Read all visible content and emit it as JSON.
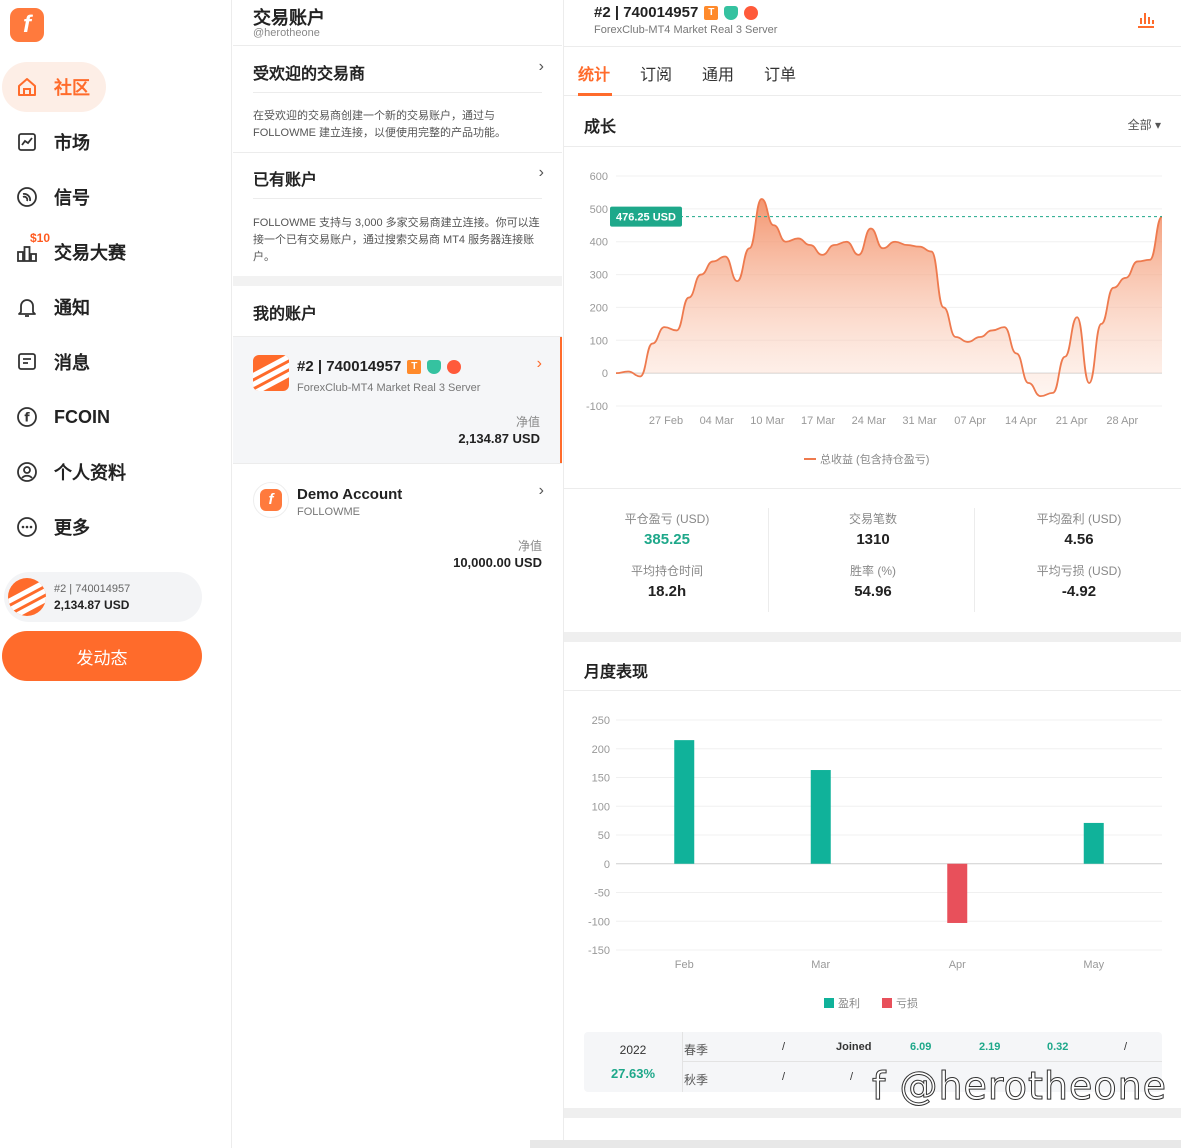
{
  "sidebar": {
    "logo": "f",
    "items": [
      {
        "label": "社区",
        "icon": "home-icon",
        "active": true
      },
      {
        "label": "市场",
        "icon": "market-chart-icon"
      },
      {
        "label": "信号",
        "icon": "signal-icon"
      },
      {
        "label": "交易大赛",
        "icon": "contest-bar-icon",
        "badge": "$10"
      },
      {
        "label": "通知",
        "icon": "bell-icon"
      },
      {
        "label": "消息",
        "icon": "message-icon"
      },
      {
        "label": "FCOIN",
        "icon": "fcoin-icon"
      },
      {
        "label": "个人资料",
        "icon": "profile-icon"
      },
      {
        "label": "更多",
        "icon": "more-icon"
      }
    ],
    "account": {
      "id_line": "#2 | 740014957",
      "balance": "2,134.87 USD"
    },
    "post_button": "发动态"
  },
  "middle": {
    "title": "交易账户",
    "handle": "@herotheone",
    "popular": {
      "title": "受欢迎的交易商",
      "desc": "在受欢迎的交易商创建一个新的交易账户，通过与 FOLLOWME 建立连接，以便使用完整的产品功能。"
    },
    "existing": {
      "title": "已有账户",
      "desc": "FOLLOWME 支持与 3,000 多家交易商建立连接。你可以连接一个已有交易账户，通过搜索交易商 MT4 服务器连接账户。"
    },
    "my_accounts_title": "我的账户",
    "accounts": [
      {
        "name": "#2 | 740014957",
        "server": "ForexClub-MT4 Market Real 3 Server",
        "equity_label": "净值",
        "equity": "2,134.87 USD"
      },
      {
        "name": "Demo Account",
        "server": "FOLLOWME",
        "equity_label": "净值",
        "equity": "10,000.00 USD"
      }
    ]
  },
  "right": {
    "account_title": "#2 | 740014957",
    "account_server": "ForexClub-MT4 Market Real 3 Server",
    "tabs": [
      "统计",
      "订阅",
      "通用",
      "订单"
    ],
    "growth_title": "成长",
    "filter": "全部",
    "monthly_title": "月度表现",
    "stats": [
      {
        "label": "平仓盈亏 (USD)",
        "value": "385.25",
        "green": true
      },
      {
        "label": "交易笔数",
        "value": "1310"
      },
      {
        "label": "平均盈利 (USD)",
        "value": "4.56"
      },
      {
        "label": "平均持仓时间",
        "value": "18.2h"
      },
      {
        "label": "胜率 (%)",
        "value": "54.96"
      },
      {
        "label": "平均亏损 (USD)",
        "value": "-4.92"
      }
    ],
    "season": {
      "year": "2022",
      "pct": "27.63%",
      "rows": [
        {
          "label": "春季",
          "cells": [
            "/",
            "Joined",
            "6.09",
            "2.19",
            "0.32",
            "/"
          ]
        },
        {
          "label": "秋季",
          "cells": [
            "/",
            "/"
          ]
        }
      ]
    },
    "watermark": "f @herotheone"
  },
  "chart_data": [
    {
      "type": "area",
      "title": "成长",
      "ylim": [
        -100,
        600
      ],
      "yticks": [
        600,
        500,
        400,
        300,
        200,
        100,
        0,
        -100
      ],
      "xticks": [
        "27 Feb",
        "04 Mar",
        "10 Mar",
        "17 Mar",
        "24 Mar",
        "31 Mar",
        "07 Apr",
        "14 Apr",
        "21 Apr",
        "28 Apr"
      ],
      "grid": true,
      "legend": "bottom",
      "series": [
        {
          "name": "总收益 (包含持仓盈亏)",
          "color": "#f08a5d",
          "values": [
            0,
            5,
            -10,
            90,
            140,
            130,
            230,
            300,
            340,
            355,
            280,
            380,
            530,
            450,
            400,
            410,
            390,
            360,
            390,
            400,
            360,
            440,
            380,
            400,
            390,
            385,
            370,
            200,
            110,
            95,
            110,
            130,
            140,
            60,
            -30,
            -70,
            -60,
            50,
            170,
            -30,
            150,
            260,
            290,
            340,
            345,
            476
          ]
        }
      ],
      "marker": {
        "value": 476.25,
        "label": "476.25 USD"
      }
    },
    {
      "type": "bar",
      "title": "月度表现",
      "ylim": [
        -150,
        250
      ],
      "yticks": [
        250,
        200,
        150,
        100,
        50,
        0,
        -50,
        -100,
        -150
      ],
      "categories": [
        "Feb",
        "Mar",
        "Apr",
        "May"
      ],
      "values": [
        215,
        163,
        -103,
        71
      ],
      "legend": [
        "盈利",
        "亏损"
      ],
      "colors": {
        "profit": "#10b29a",
        "loss": "#e8505b"
      }
    }
  ]
}
